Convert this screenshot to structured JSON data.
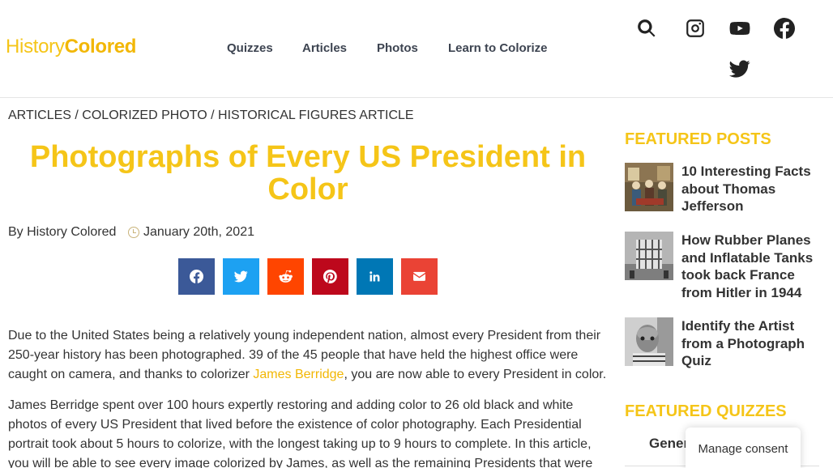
{
  "header": {
    "logo": {
      "part1": "History",
      "part2": "Colored"
    },
    "nav": [
      {
        "label": "Quizzes"
      },
      {
        "label": "Articles"
      },
      {
        "label": "Photos"
      },
      {
        "label": "Learn to Colorize"
      }
    ],
    "icons": [
      "search-icon",
      "instagram-icon",
      "youtube-icon",
      "facebook-icon",
      "twitter-icon"
    ]
  },
  "breadcrumb": {
    "crumb1": "ARTICLES",
    "sep1": " / ",
    "crumb2": "COLORIZED PHOTO",
    "sep2": " / ",
    "crumb3": "HISTORICAL FIGURES ARTICLE"
  },
  "article": {
    "title": "Photographs of Every US President in Color",
    "author": "By History Colored",
    "date": "January 20th, 2021",
    "share_buttons": [
      {
        "name": "facebook",
        "color": "#3b5998"
      },
      {
        "name": "twitter",
        "color": "#1da1f2"
      },
      {
        "name": "reddit",
        "color": "#ff4500"
      },
      {
        "name": "pinterest",
        "color": "#bd081c"
      },
      {
        "name": "linkedin",
        "color": "#0077b5"
      },
      {
        "name": "email",
        "color": "#ea4335"
      }
    ],
    "p1_before": "Due to the United States being a relatively young independent nation, almost every President from their 250-year history has been photographed. 39 of the 45 people that have held the highest office were caught on camera, and thanks to colorizer ",
    "p1_link": "James Berridge",
    "p1_after": ", you are now able to every President in color.",
    "p2": "James Berridge spent over 100 hours expertly restoring and adding color to 26 old black and white photos of every US President that lived before the existence of color photography. Each Presidential portrait took about 5 hours to colorize, with the longest taking up to 9 hours to complete. In this article, you will be able to see every image colorized by James, as well as the remaining Presidents that were"
  },
  "sidebar": {
    "featured_posts_heading": "FEATURED POSTS",
    "posts": [
      {
        "title": "10 Interesting Facts about Thomas Jefferson"
      },
      {
        "title": "How Rubber Planes and Inflatable Tanks took back France from Hitler in 1944"
      },
      {
        "title": "Identify the Artist from a Photograph Quiz"
      }
    ],
    "featured_quizzes_heading": "FEATURED QUIZZES",
    "quiz_partial": "Gener"
  },
  "consent": {
    "label": "Manage consent"
  },
  "colors": {
    "accent": "#f5c518",
    "text": "#333333"
  }
}
